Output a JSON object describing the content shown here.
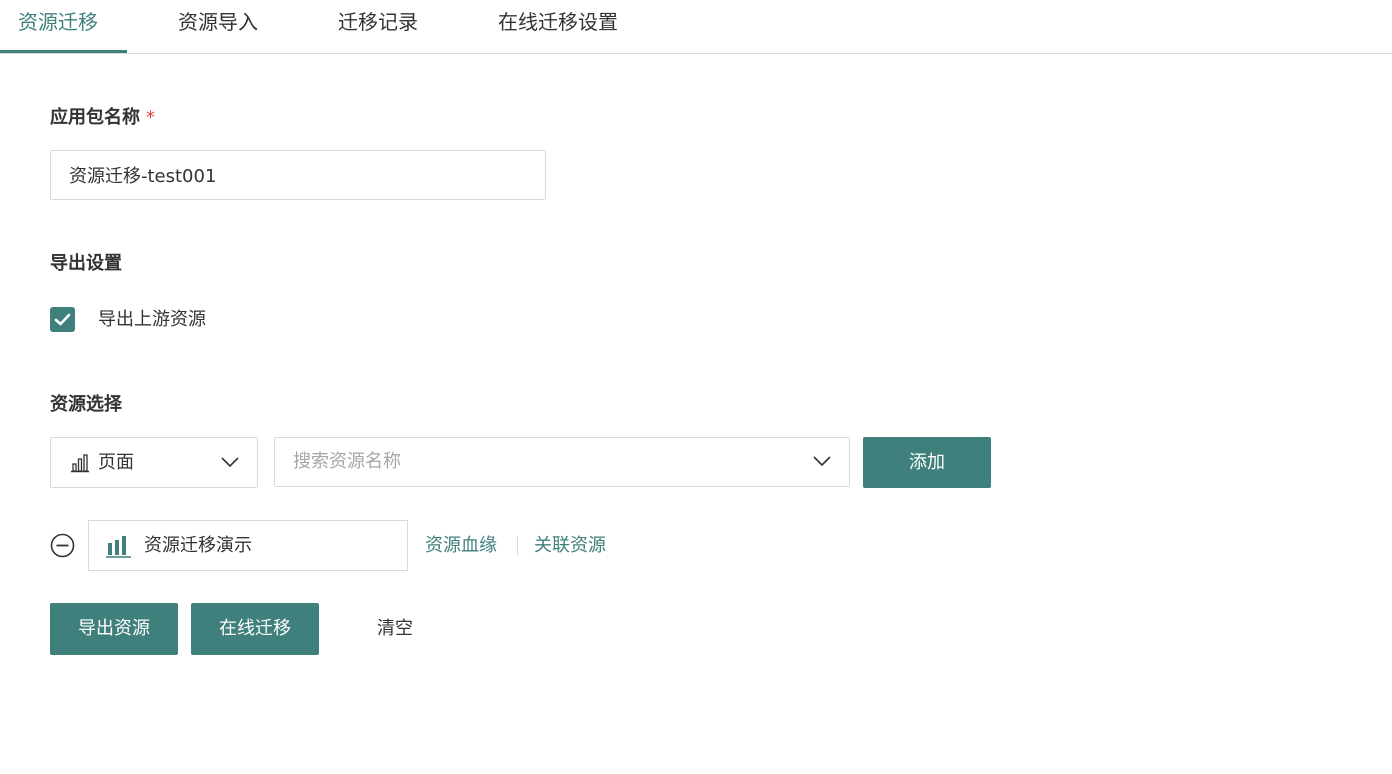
{
  "tabs": [
    {
      "label": "资源迁移",
      "active": true
    },
    {
      "label": "资源导入",
      "active": false
    },
    {
      "label": "迁移记录",
      "active": false
    },
    {
      "label": "在线迁移设置",
      "active": false
    }
  ],
  "form": {
    "package_name_label": "应用包名称",
    "required_mark": "*",
    "package_name_value": "资源迁移-test001",
    "export_settings_label": "导出设置",
    "export_upstream_label": "导出上游资源",
    "export_upstream_checked": true,
    "resource_select_label": "资源选择",
    "resource_type": "页面",
    "search_placeholder": "搜索资源名称",
    "add_label": "添加"
  },
  "selected_resources": [
    {
      "name": "资源迁移演示",
      "icon": "bar-chart-icon",
      "lineage_link": "资源血缘",
      "related_link": "关联资源"
    }
  ],
  "actions": {
    "export_label": "导出资源",
    "online_migrate_label": "在线迁移",
    "clear_label": "清空"
  },
  "colors": {
    "accent": "#3f7f7c",
    "required": "#e0443e",
    "border": "#d9d9d9",
    "placeholder": "#a6a6a6"
  }
}
